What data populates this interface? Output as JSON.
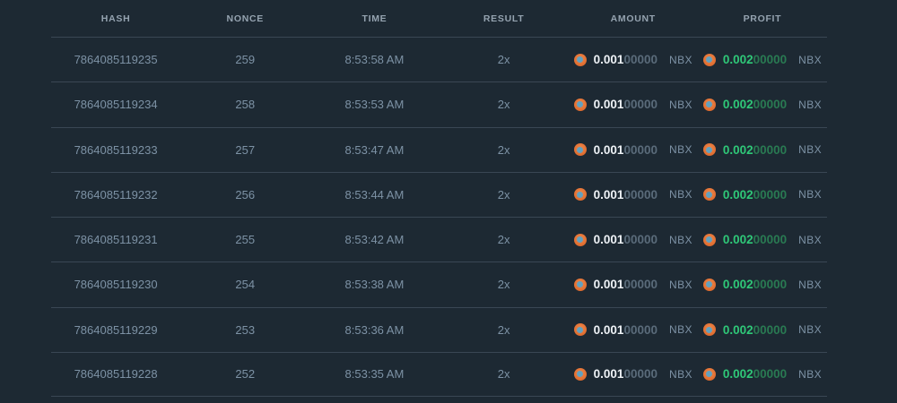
{
  "table": {
    "columns": [
      {
        "key": "hash",
        "label": "HASH"
      },
      {
        "key": "nonce",
        "label": "NONCE"
      },
      {
        "key": "time",
        "label": "TIME"
      },
      {
        "key": "result",
        "label": "RESULT"
      },
      {
        "key": "amount",
        "label": "AMOUNT"
      },
      {
        "key": "profit",
        "label": "PROFIT"
      }
    ],
    "currency": "NBX",
    "icons": {
      "coin": "coin-icon"
    },
    "colors": {
      "background": "#1d2933",
      "divider": "#3a4754",
      "header_text": "#95a3b0",
      "row_text": "#7d92a5",
      "amount_main": "#eef2f6",
      "amount_zeros": "#5a6b7a",
      "profit_main": "#2fc878",
      "profit_zeros": "#297a52",
      "coin_orange": "#e8773d",
      "coin_center": "#63a1bf"
    },
    "rows": [
      {
        "hash": "7864085119235",
        "nonce": "259",
        "time": "8:53:58 AM",
        "result": "2x",
        "amount_main": "0.001",
        "amount_zeros": "00000",
        "profit_main": "0.002",
        "profit_zeros": "00000"
      },
      {
        "hash": "7864085119234",
        "nonce": "258",
        "time": "8:53:53 AM",
        "result": "2x",
        "amount_main": "0.001",
        "amount_zeros": "00000",
        "profit_main": "0.002",
        "profit_zeros": "00000"
      },
      {
        "hash": "7864085119233",
        "nonce": "257",
        "time": "8:53:47 AM",
        "result": "2x",
        "amount_main": "0.001",
        "amount_zeros": "00000",
        "profit_main": "0.002",
        "profit_zeros": "00000"
      },
      {
        "hash": "7864085119232",
        "nonce": "256",
        "time": "8:53:44 AM",
        "result": "2x",
        "amount_main": "0.001",
        "amount_zeros": "00000",
        "profit_main": "0.002",
        "profit_zeros": "00000"
      },
      {
        "hash": "7864085119231",
        "nonce": "255",
        "time": "8:53:42 AM",
        "result": "2x",
        "amount_main": "0.001",
        "amount_zeros": "00000",
        "profit_main": "0.002",
        "profit_zeros": "00000"
      },
      {
        "hash": "7864085119230",
        "nonce": "254",
        "time": "8:53:38 AM",
        "result": "2x",
        "amount_main": "0.001",
        "amount_zeros": "00000",
        "profit_main": "0.002",
        "profit_zeros": "00000"
      },
      {
        "hash": "7864085119229",
        "nonce": "253",
        "time": "8:53:36 AM",
        "result": "2x",
        "amount_main": "0.001",
        "amount_zeros": "00000",
        "profit_main": "0.002",
        "profit_zeros": "00000"
      },
      {
        "hash": "7864085119228",
        "nonce": "252",
        "time": "8:53:35 AM",
        "result": "2x",
        "amount_main": "0.001",
        "amount_zeros": "00000",
        "profit_main": "0.002",
        "profit_zeros": "00000"
      }
    ]
  }
}
